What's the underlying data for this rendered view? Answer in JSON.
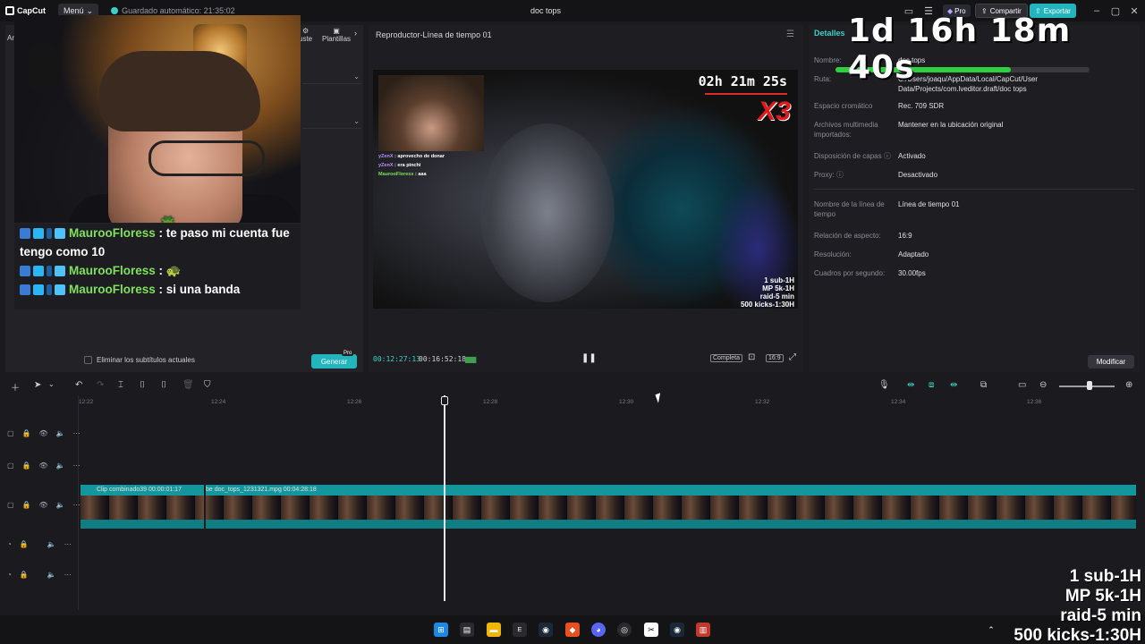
{
  "titlebar": {
    "app_name": "CapCut",
    "menu_label": "Menú",
    "autosave_text": "Guardado automático: 21:35:02",
    "project_title": "doc tops",
    "pro_label": "Pro",
    "share_label": "Compartir",
    "export_label": "Exportar"
  },
  "left_panel": {
    "tab_adjust": "uste",
    "tab_templates": "Plantillas",
    "left_cut_label": "Ar",
    "remove_subtitles_label": "Eliminar los subtítulos actuales",
    "generate_label": "Generar",
    "pro_badge": "Pro"
  },
  "overlay": {
    "big_timer": "1d 16h 18m 40s",
    "progress_fraction": 0.69,
    "chat": [
      {
        "user": "MaurooFloress",
        "text": " : te paso mi cuenta fue tengo como 10"
      },
      {
        "user": "MaurooFloress",
        "text": " : 🐢"
      },
      {
        "user": "MaurooFloress",
        "text": " : si una banda"
      }
    ],
    "stats": [
      "1 sub-1H",
      "MP 5k-1H",
      "raid-5 min",
      "500 kicks-1:30H"
    ]
  },
  "player": {
    "title": "Reproductor-Línea de tiempo 01",
    "inner_timer": "02h 21m 25s",
    "multiplier": "X3",
    "inner_stats": [
      "1 sub-1H",
      "MP 5k-1H",
      "raid-5 min",
      "500 kicks-1:30H"
    ],
    "inner_chat": [
      {
        "user": "yZenX",
        "text": " : aprovecho de donar"
      },
      {
        "user": "yZenX",
        "text": " : era pinchi"
      },
      {
        "user": "MaurooFloress",
        "text": " : aaa"
      }
    ],
    "time_current": "00:12:27:13",
    "time_total": "00:16:52:18",
    "full_label": "Completa",
    "ratio_label": "16:9"
  },
  "details": {
    "tab": "Detalles",
    "rows": [
      {
        "label": "Nombre:",
        "value": "doc tops"
      },
      {
        "label": "Ruta:",
        "value": "C:/Users/joaqu/AppData/Local/CapCut/User Data/Projects/com.lveditor.draft/doc tops"
      },
      {
        "label": "Espacio cromático",
        "value": "Rec. 709 SDR"
      },
      {
        "label": "Archivos multimedia importados:",
        "value": "Mantener en la ubicación original"
      },
      {
        "label": "Disposición de capas ⓘ",
        "value": "Activado"
      },
      {
        "label": "Proxy: ⓘ",
        "value": "Desactivado"
      },
      {
        "label": "Nombre de la línea de tiempo",
        "value": "Línea de tiempo 01"
      },
      {
        "label": "Relación de aspecto:",
        "value": "16:9"
      },
      {
        "label": "Resolución:",
        "value": "Adaptado"
      },
      {
        "label": "Cuadros por segundo:",
        "value": "30.00fps"
      }
    ],
    "modify_label": "Modificar"
  },
  "timeline": {
    "ruler_ticks": [
      "12:22",
      "12:24",
      "12:26",
      "12:28",
      "12:30",
      "12:32",
      "12:34",
      "12:36"
    ],
    "clip1_label": "Clip combinado39  00:00:01:17",
    "clip2_label": "be  doc_tops_1231321.mpg  00:04:28:18",
    "zoom_fraction": 0.55
  },
  "icons": {
    "accent": "#22b5bd",
    "accent_text": "#3cd0c9",
    "green_progress": "#2ed13d",
    "chat_user": "#7fe05a"
  }
}
